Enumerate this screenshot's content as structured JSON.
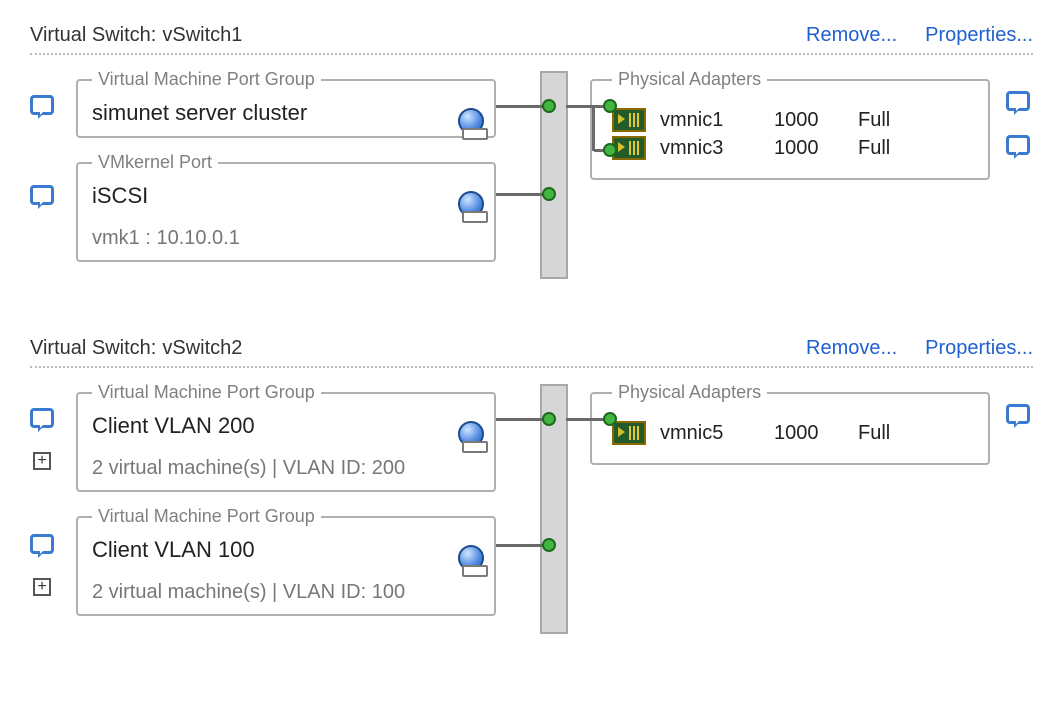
{
  "labels": {
    "vswitch_prefix": "Virtual Switch:",
    "remove": "Remove...",
    "properties": "Properties...",
    "vm_port_group": "Virtual Machine Port Group",
    "vmkernel_port": "VMkernel Port",
    "physical_adapters": "Physical Adapters"
  },
  "switches": [
    {
      "name": "vSwitch1",
      "port_groups": [
        {
          "type": "vmpg",
          "title": "simunet server cluster",
          "sub": ""
        },
        {
          "type": "vmk",
          "title": "iSCSI",
          "sub": "vmk1 : 10.10.0.1"
        }
      ],
      "adapters": [
        {
          "name": "vmnic1",
          "speed": "1000",
          "duplex": "Full"
        },
        {
          "name": "vmnic3",
          "speed": "1000",
          "duplex": "Full"
        }
      ]
    },
    {
      "name": "vSwitch2",
      "port_groups": [
        {
          "type": "vmpg",
          "title": "Client VLAN 200",
          "sub": "2 virtual machine(s) | VLAN ID: 200"
        },
        {
          "type": "vmpg",
          "title": "Client VLAN 100",
          "sub": "2 virtual machine(s) | VLAN ID: 100"
        }
      ],
      "adapters": [
        {
          "name": "vmnic5",
          "speed": "1000",
          "duplex": "Full"
        }
      ]
    }
  ]
}
